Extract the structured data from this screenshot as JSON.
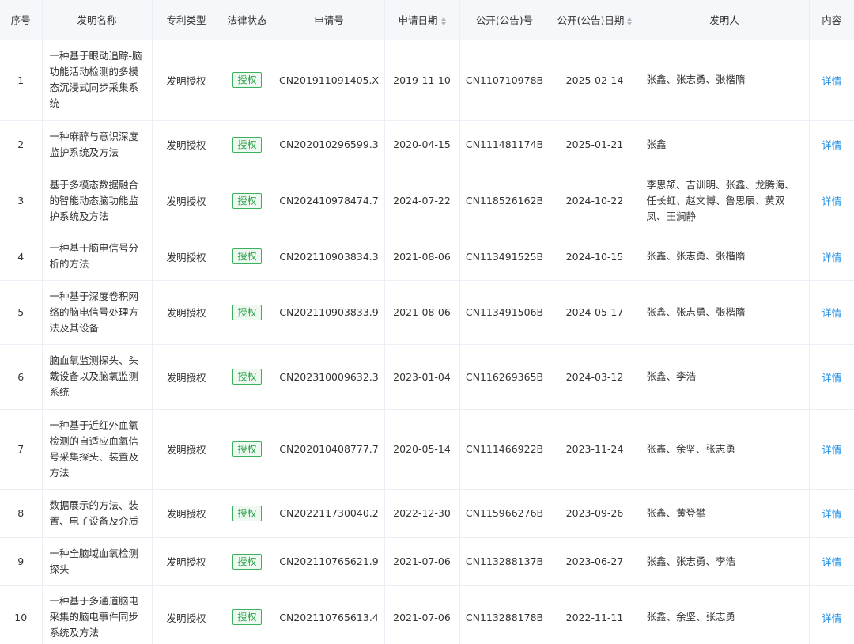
{
  "table": {
    "headers": {
      "index": "序号",
      "name": "发明名称",
      "type": "专利类型",
      "status": "法律状态",
      "app_no": "申请号",
      "app_date": "申请日期",
      "pub_no": "公开(公告)号",
      "pub_date": "公开(公告)日期",
      "inventors": "发明人",
      "content": "内容"
    },
    "rows": [
      {
        "index": "1",
        "name": "一种基于眼动追踪-脑功能活动检测的多模态沉浸式同步采集系统",
        "type": "发明授权",
        "status": "授权",
        "app_no": "CN201911091405.X",
        "app_date": "2019-11-10",
        "pub_no": "CN110710978B",
        "pub_date": "2025-02-14",
        "inventors": "张鑫、张志勇、张楷隋",
        "detail": "详情"
      },
      {
        "index": "2",
        "name": "一种麻醉与意识深度监护系统及方法",
        "type": "发明授权",
        "status": "授权",
        "app_no": "CN202010296599.3",
        "app_date": "2020-04-15",
        "pub_no": "CN111481174B",
        "pub_date": "2025-01-21",
        "inventors": "张鑫",
        "detail": "详情"
      },
      {
        "index": "3",
        "name": "基于多模态数据融合的智能动态脑功能监护系统及方法",
        "type": "发明授权",
        "status": "授权",
        "app_no": "CN202410978474.7",
        "app_date": "2024-07-22",
        "pub_no": "CN118526162B",
        "pub_date": "2024-10-22",
        "inventors": "李思颉、吉训明、张鑫、龙腾海、任长虹、赵文博、鲁思辰、黄双凤、王澜静",
        "detail": "详情"
      },
      {
        "index": "4",
        "name": "一种基于脑电信号分析的方法",
        "type": "发明授权",
        "status": "授权",
        "app_no": "CN202110903834.3",
        "app_date": "2021-08-06",
        "pub_no": "CN113491525B",
        "pub_date": "2024-10-15",
        "inventors": "张鑫、张志勇、张楷隋",
        "detail": "详情"
      },
      {
        "index": "5",
        "name": "一种基于深度卷积网络的脑电信号处理方法及其设备",
        "type": "发明授权",
        "status": "授权",
        "app_no": "CN202110903833.9",
        "app_date": "2021-08-06",
        "pub_no": "CN113491506B",
        "pub_date": "2024-05-17",
        "inventors": "张鑫、张志勇、张楷隋",
        "detail": "详情"
      },
      {
        "index": "6",
        "name": "脑血氧监测探头、头戴设备以及脑氧监测系统",
        "type": "发明授权",
        "status": "授权",
        "app_no": "CN202310009632.3",
        "app_date": "2023-01-04",
        "pub_no": "CN116269365B",
        "pub_date": "2024-03-12",
        "inventors": "张鑫、李浩",
        "detail": "详情"
      },
      {
        "index": "7",
        "name": "一种基于近红外血氧检测的自适应血氧信号采集探头、装置及方法",
        "type": "发明授权",
        "status": "授权",
        "app_no": "CN202010408777.7",
        "app_date": "2020-05-14",
        "pub_no": "CN111466922B",
        "pub_date": "2023-11-24",
        "inventors": "张鑫、余坚、张志勇",
        "detail": "详情"
      },
      {
        "index": "8",
        "name": "数据展示的方法、装置、电子设备及介质",
        "type": "发明授权",
        "status": "授权",
        "app_no": "CN202211730040.2",
        "app_date": "2022-12-30",
        "pub_no": "CN115966276B",
        "pub_date": "2023-09-26",
        "inventors": "张鑫、黄登攀",
        "detail": "详情"
      },
      {
        "index": "9",
        "name": "一种全脑域血氧检测探头",
        "type": "发明授权",
        "status": "授权",
        "app_no": "CN202110765621.9",
        "app_date": "2021-07-06",
        "pub_no": "CN113288137B",
        "pub_date": "2023-06-27",
        "inventors": "张鑫、张志勇、李浩",
        "detail": "详情"
      },
      {
        "index": "10",
        "name": "一种基于多通道脑电采集的脑电事件同步系统及方法",
        "type": "发明授权",
        "status": "授权",
        "app_no": "CN202110765613.4",
        "app_date": "2021-07-06",
        "pub_no": "CN113288178B",
        "pub_date": "2022-11-11",
        "inventors": "张鑫、余坚、张志勇",
        "detail": "详情"
      }
    ]
  },
  "colors": {
    "header_bg": "#f5f7fa",
    "border": "#ebeef5",
    "badge_green": "#3cb15b",
    "link_blue": "#1f8fe5"
  }
}
